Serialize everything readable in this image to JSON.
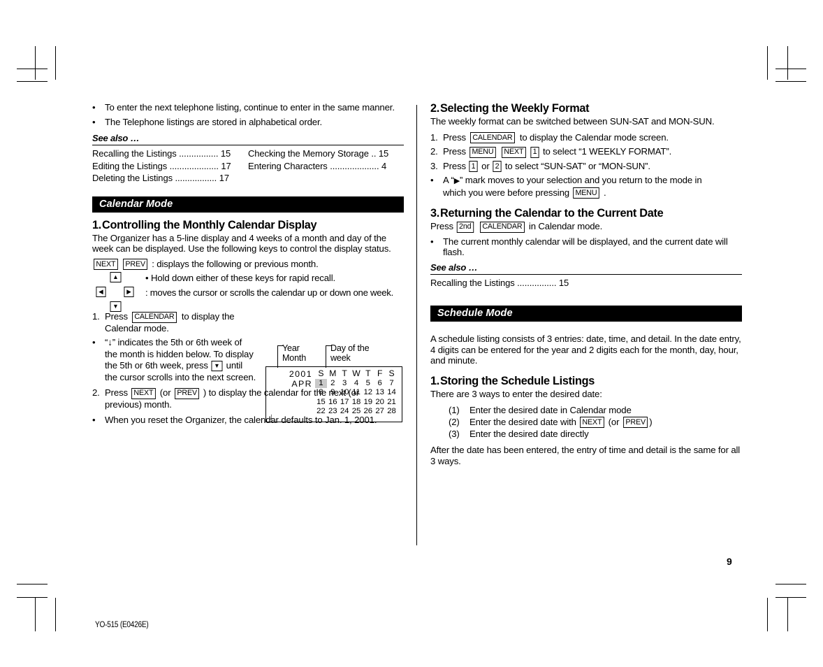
{
  "document": {
    "page_number": "9",
    "footer": "YO-515 (E0426E)"
  },
  "left_column": {
    "top_bullets": [
      "To enter the next telephone listing, continue to enter in the same manner.",
      "The Telephone listings are stored in alphabetical order."
    ],
    "see_also": {
      "heading": "See also …",
      "column1": [
        "Recalling the Listings ................ 15",
        "Editing the Listings .................... 17",
        "Deleting the Listings ................. 17"
      ],
      "column2": [
        "Checking the Memory Storage .. 15",
        "Entering Characters  .................... 4"
      ]
    },
    "banner": "Calendar Mode",
    "section1": {
      "number": "1.",
      "title": "Controlling the Monthly Calendar Display",
      "intro": "The Organizer has a 5-line display and 4 weeks of a month and day of the week can be displayed. Use the following keys to control the display status.",
      "key_next": "NEXT",
      "key_prev": "PREV",
      "keyline_text": ": displays the following or previous month.",
      "keypad": {
        "up": "▲",
        "left": "◀",
        "right": "▶",
        "down": "▼",
        "note": "• Hold down either of these keys for rapid recall.",
        "desc": ": moves the cursor or scrolls the calendar up or down one week."
      },
      "step1": {
        "mark": "1.",
        "pre": "Press ",
        "key": "CALENDAR",
        "post": " to display the",
        "line2": "Calendar mode."
      },
      "bullet_arrow": {
        "mark": "•",
        "part1": "“",
        "arrow": "↓",
        "part2": "” indicates the 5th or 6th week of",
        "line2": "the month is hidden below. To display",
        "line3_pre": "the 5th or 6th week, press ",
        "line3_key": "▼",
        "line3_post": " until",
        "line4": "the cursor scrolls into the next screen."
      },
      "step2": {
        "mark": "2.",
        "pre": "Press ",
        "key1": "NEXT",
        "mid": " (or ",
        "key2": "PREV",
        "post": " ) to display the calendar for the next (or",
        "line2": "previous) month."
      },
      "bullet_reset": "When you reset the Organizer, the calendar defaults to Jan. 1, 2001."
    },
    "calendar_figure": {
      "label_year": "Year",
      "label_month": "Month",
      "label_dow_line1": "Day of the",
      "label_dow_line2": "week",
      "year": "2001",
      "month": "APR",
      "weekday_headers": [
        "S",
        "M",
        "T",
        "W",
        "T",
        "F",
        "S"
      ],
      "weeks": [
        [
          "1",
          "2",
          "3",
          "4",
          "5",
          "6",
          "7"
        ],
        [
          "8",
          "9",
          "10",
          "11",
          "12",
          "13",
          "14"
        ],
        [
          "15",
          "16",
          "17",
          "18",
          "19",
          "20",
          "21"
        ],
        [
          "22",
          "23",
          "24",
          "25",
          "26",
          "27",
          "28"
        ]
      ],
      "selected_day": "1",
      "scroll_indicator": "↓"
    }
  },
  "right_column": {
    "section2": {
      "number": "2.",
      "title": "Selecting the Weekly Format",
      "intro": "The weekly format can be switched between SUN-SAT and MON-SUN.",
      "step1": {
        "mark": "1.",
        "pre": "Press ",
        "key": "CALENDAR",
        "post": " to display the Calendar mode screen."
      },
      "step2": {
        "mark": "2.",
        "pre": "Press ",
        "key1": "MENU",
        "key2": "NEXT",
        "key3": "1",
        "post": " to select “1 WEEKLY FORMAT”."
      },
      "step3": {
        "mark": "3.",
        "pre": "Press ",
        "key1": "1",
        "mid": " or ",
        "key2": "2",
        "post": " to select “SUN-SAT” or “MON-SUN”."
      },
      "bullet": {
        "mark": "•",
        "pre": "A “",
        "glyph": "▶",
        "post": "” mark moves to your selection and you return to the mode in",
        "line2_pre": "which you were before pressing ",
        "line2_key": "MENU",
        "line2_post": " ."
      }
    },
    "section3": {
      "number": "3.",
      "title": "Returning the Calendar to the Current Date",
      "line_pre": "Press ",
      "key1": "2nd",
      "key2": "CALENDAR",
      "line_post": " in Calendar mode.",
      "bullet": "The current monthly calendar will be displayed, and the current date will flash.",
      "see_also": {
        "heading": "See also …",
        "entry": "Recalling the Listings ................ 15"
      }
    },
    "banner": "Schedule Mode",
    "schedule_intro": "A schedule listing consists of 3 entries: date, time, and detail. In the date entry, 4 digits can be entered for the year and 2 digits each for the month, day, hour, and minute.",
    "section_storing": {
      "number": "1.",
      "title": "Storing the Schedule Listings",
      "intro": "There are 3 ways to enter the desired date:",
      "items": [
        {
          "mark": "(1)",
          "pre": "Enter the desired date in Calendar mode",
          "key1": "",
          "mid": "",
          "key2": "",
          "post": ""
        },
        {
          "mark": "(2)",
          "pre": "Enter the desired date with ",
          "key1": "NEXT",
          "mid": " (or ",
          "key2": "PREV",
          "post": ")"
        },
        {
          "mark": "(3)",
          "pre": "Enter the desired date directly",
          "key1": "",
          "mid": "",
          "key2": "",
          "post": ""
        }
      ],
      "outro": "After the date has been entered, the entry of time and detail is the same for all 3 ways."
    }
  }
}
